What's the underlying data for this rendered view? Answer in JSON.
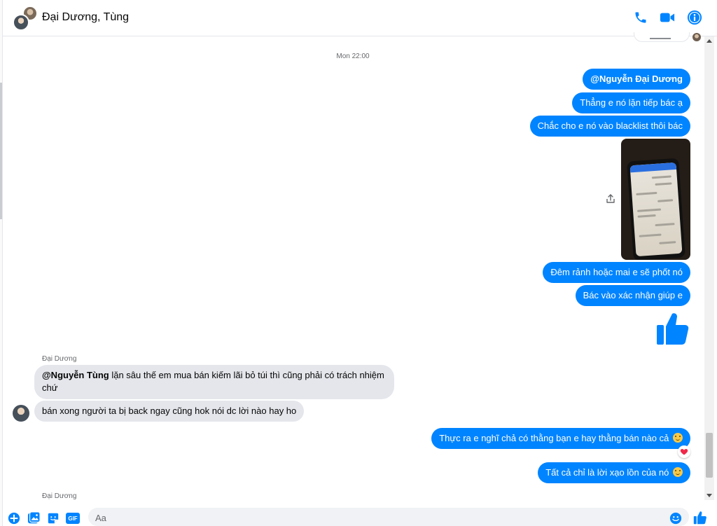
{
  "header": {
    "title": "Đại Dương, Tùng",
    "icons": [
      "phone-icon",
      "video-icon",
      "info-icon"
    ]
  },
  "conversation": {
    "timestamp": "Mon 22:00",
    "outgoing_1": {
      "mention": "@Nguyễn Đại Dương"
    },
    "outgoing_2": "Thẳng e nó lặn tiếp bác ạ",
    "outgoing_3": "Chắc cho e nó vào blacklist thôi bác",
    "outgoing_4": "Đêm rảnh hoặc mai e sẽ phốt nó",
    "outgoing_5": "Bác vào xác nhận giúp e",
    "incoming_sender_1": "Đại Dương",
    "incoming_1": {
      "mention": "@Nguyễn Tùng",
      "text_line1": " lặn sâu thế em mua bán kiếm lãi bỏ túi thì cũng phải có trách nhiệm",
      "text_line2": "chứ"
    },
    "incoming_2": "bán xong người ta bị back ngay cũng hok nói dc lời nào hay ho",
    "outgoing_6": "Thực ra e nghĩ chả có thằng bạn e hay thằng bán nào cả",
    "outgoing_6_reaction": "heart",
    "outgoing_7": "Tất cả chỉ là lời xạo lồn của nó",
    "incoming_sender_2": "Đại Dương"
  },
  "composer": {
    "placeholder": "Aa",
    "icons": [
      "plus-icon",
      "image-icon",
      "sticker-icon",
      "gif-icon",
      "emoji-icon",
      "like-icon"
    ],
    "gif_label": "GIF"
  },
  "colors": {
    "accent": "#0084ff",
    "incoming_bubble": "#e4e6eb",
    "header_border": "#e4e6eb"
  }
}
